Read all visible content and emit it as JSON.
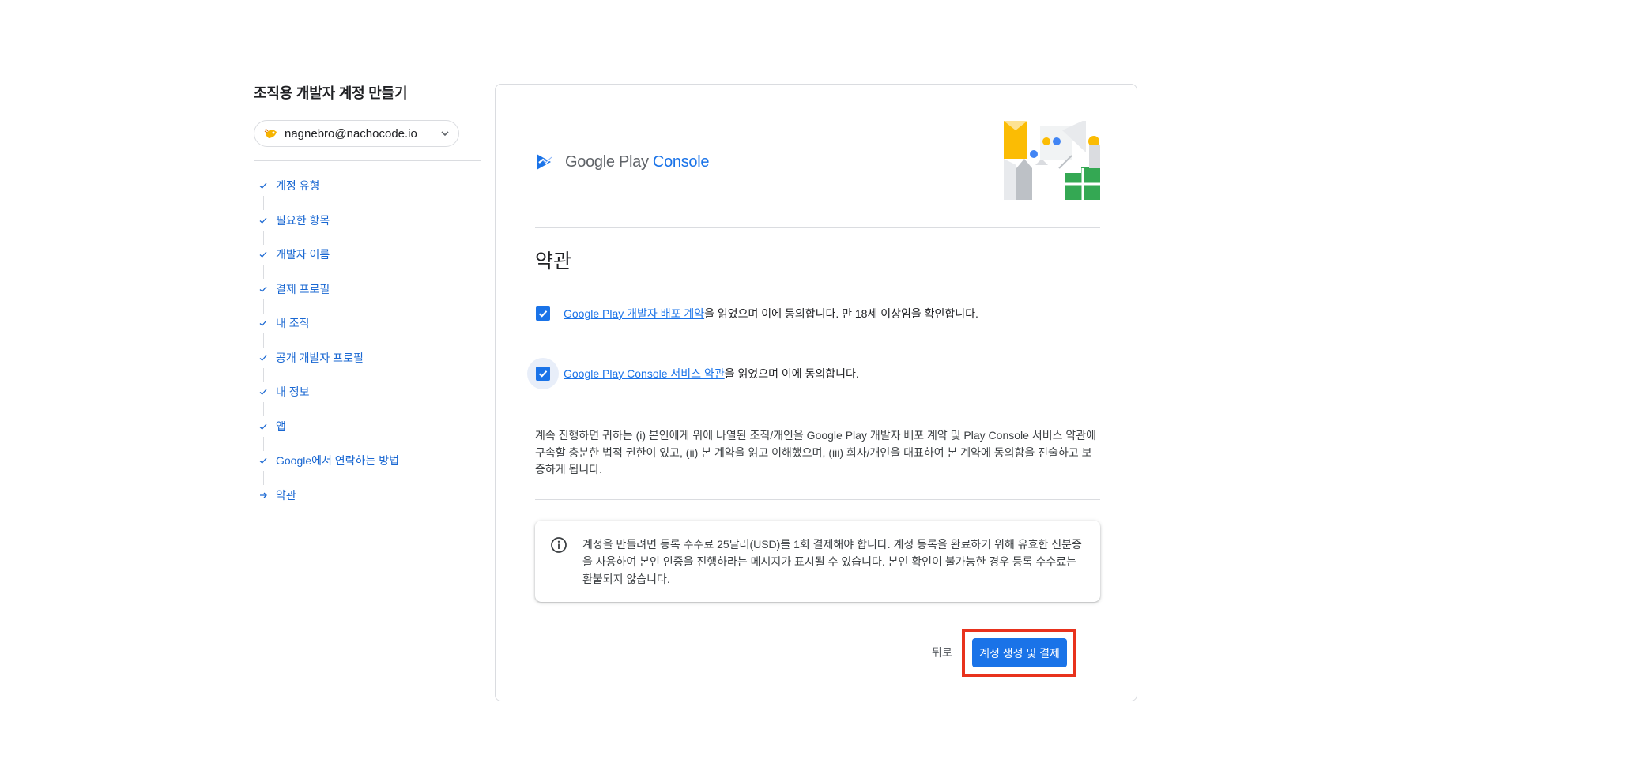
{
  "sidebar": {
    "title": "조직용 개발자 계정 만들기",
    "account_email": "nagnebro@nachocode.io",
    "steps": [
      {
        "label": "계정 유형",
        "state": "done"
      },
      {
        "label": "필요한 항목",
        "state": "done"
      },
      {
        "label": "개발자 이름",
        "state": "done"
      },
      {
        "label": "결제 프로필",
        "state": "done"
      },
      {
        "label": "내 조직",
        "state": "done"
      },
      {
        "label": "공개 개발자 프로필",
        "state": "done"
      },
      {
        "label": "내 정보",
        "state": "done"
      },
      {
        "label": "앱",
        "state": "done"
      },
      {
        "label": "Google에서 연락하는 방법",
        "state": "done"
      },
      {
        "label": "약관",
        "state": "current"
      }
    ]
  },
  "card": {
    "logo": {
      "brand": "Google Play",
      "product": "Console"
    },
    "section_title": "약관",
    "agreements": [
      {
        "link": "Google Play 개발자 배포 계약",
        "text": "을 읽었으며 이에 동의합니다. 만 18세 이상임을 확인합니다.",
        "checked": true
      },
      {
        "link": "Google Play Console 서비스 약관",
        "text": "을 읽었으며 이에 동의합니다.",
        "checked": true
      }
    ],
    "terms_description": "계속 진행하면 귀하는 (i) 본인에게 위에 나열된 조직/개인을 Google Play 개발자 배포 계약 및 Play Console 서비스 약관에 구속할 충분한 법적 권한이 있고, (ii) 본 계약을 읽고 이해했으며, (iii) 회사/개인을 대표하여 본 계약에 동의함을 진술하고 보증하게 됩니다.",
    "notice": "계정을 만들려면 등록 수수료 25달러(USD)를 1회 결제해야 합니다. 계정 등록을 완료하기 위해 유효한 신분증을 사용하여 본인 인증을 진행하라는 메시지가 표시될 수 있습니다. 본인 확인이 불가능한 경우 등록 수수료는 환불되지 않습니다.",
    "back_label": "뒤로",
    "primary_label": "계정 생성 및 결제"
  },
  "colors": {
    "accent": "#1a73e8",
    "highlight": "#e8321d",
    "step_text": "#1967d2"
  }
}
